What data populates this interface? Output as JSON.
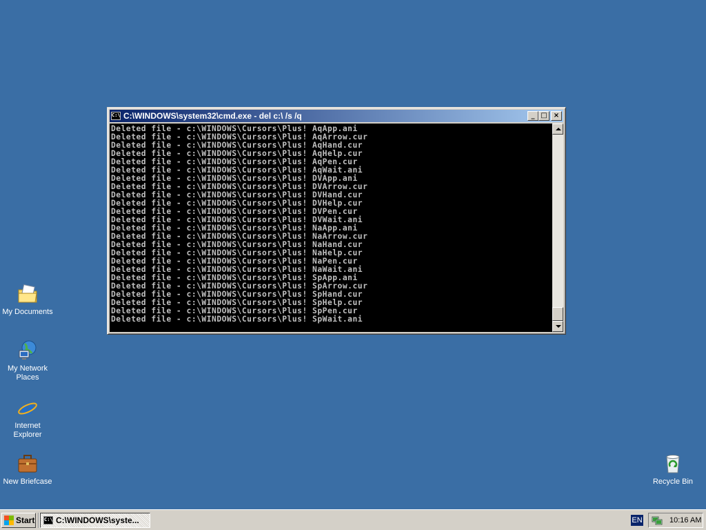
{
  "desktop": {
    "background_color": "#3a6ea5",
    "icons": [
      {
        "label": "My Documents",
        "icon": "my-documents-icon"
      },
      {
        "label_line1": "My Network",
        "label_line2": "Places",
        "icon": "network-places-icon"
      },
      {
        "label_line1": "Internet",
        "label_line2": "Explorer",
        "icon": "internet-explorer-icon"
      },
      {
        "label": "New Briefcase",
        "icon": "briefcase-icon"
      },
      {
        "label": "Recycle Bin",
        "icon": "recycle-bin-icon"
      }
    ]
  },
  "window": {
    "title": "C:\\WINDOWS\\system32\\cmd.exe - del c:\\ /s /q",
    "icon_text": "C:\\",
    "controls": {
      "minimize": "_",
      "maximize": "□",
      "close": "×"
    },
    "console_lines": [
      "Deleted file - c:\\WINDOWS\\Cursors\\Plus! AqApp.ani",
      "Deleted file - c:\\WINDOWS\\Cursors\\Plus! AqArrow.cur",
      "Deleted file - c:\\WINDOWS\\Cursors\\Plus! AqHand.cur",
      "Deleted file - c:\\WINDOWS\\Cursors\\Plus! AqHelp.cur",
      "Deleted file - c:\\WINDOWS\\Cursors\\Plus! AqPen.cur",
      "Deleted file - c:\\WINDOWS\\Cursors\\Plus! AqWait.ani",
      "Deleted file - c:\\WINDOWS\\Cursors\\Plus! DVApp.ani",
      "Deleted file - c:\\WINDOWS\\Cursors\\Plus! DVArrow.cur",
      "Deleted file - c:\\WINDOWS\\Cursors\\Plus! DVHand.cur",
      "Deleted file - c:\\WINDOWS\\Cursors\\Plus! DVHelp.cur",
      "Deleted file - c:\\WINDOWS\\Cursors\\Plus! DVPen.cur",
      "Deleted file - c:\\WINDOWS\\Cursors\\Plus! DVWait.ani",
      "Deleted file - c:\\WINDOWS\\Cursors\\Plus! NaApp.ani",
      "Deleted file - c:\\WINDOWS\\Cursors\\Plus! NaArrow.cur",
      "Deleted file - c:\\WINDOWS\\Cursors\\Plus! NaHand.cur",
      "Deleted file - c:\\WINDOWS\\Cursors\\Plus! NaHelp.cur",
      "Deleted file - c:\\WINDOWS\\Cursors\\Plus! NaPen.cur",
      "Deleted file - c:\\WINDOWS\\Cursors\\Plus! NaWait.ani",
      "Deleted file - c:\\WINDOWS\\Cursors\\Plus! SpApp.ani",
      "Deleted file - c:\\WINDOWS\\Cursors\\Plus! SpArrow.cur",
      "Deleted file - c:\\WINDOWS\\Cursors\\Plus! SpHand.cur",
      "Deleted file - c:\\WINDOWS\\Cursors\\Plus! SpHelp.cur",
      "Deleted file - c:\\WINDOWS\\Cursors\\Plus! SpPen.cur",
      "Deleted file - c:\\WINDOWS\\Cursors\\Plus! SpWait.ani"
    ]
  },
  "taskbar": {
    "start_label": "Start",
    "task_button_label": "C:\\WINDOWS\\syste...",
    "task_button_icon_text": "C:\\",
    "language": "EN",
    "clock": "10:16 AM"
  }
}
